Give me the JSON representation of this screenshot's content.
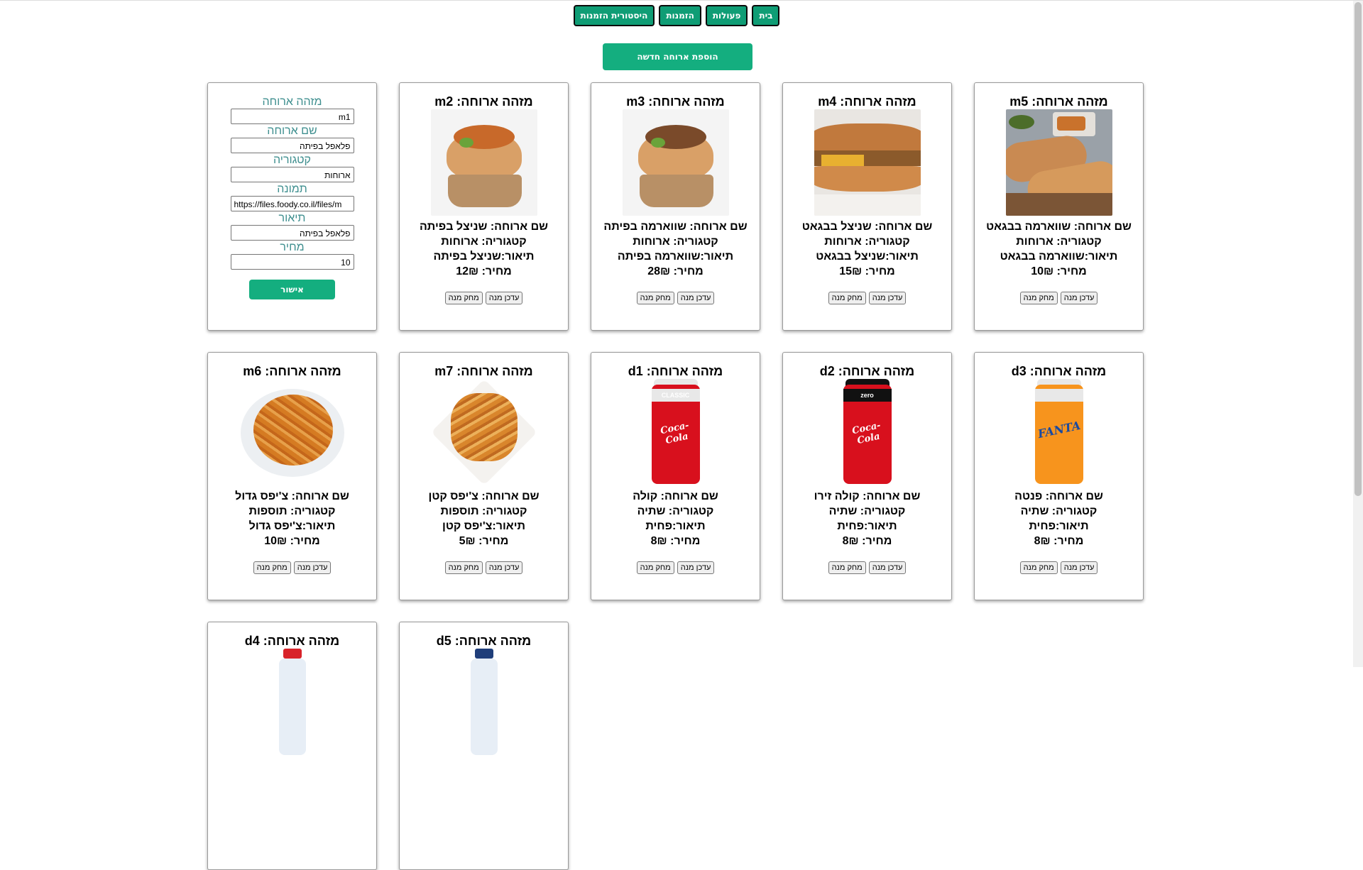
{
  "nav": {
    "items": [
      {
        "label": "בית"
      },
      {
        "label": "פעולות"
      },
      {
        "label": "הזמנות"
      },
      {
        "label": "היסטורית הזמנות"
      }
    ]
  },
  "add_meal_label": "הוספת ארוחה חדשה",
  "form": {
    "fields": [
      {
        "label": "מזהה ארוחה",
        "value": "m1"
      },
      {
        "label": "שם ארוחה",
        "value": "פלאפל בפיתה"
      },
      {
        "label": "קטגוריה",
        "value": "ארוחות"
      },
      {
        "label": "תמונה",
        "value": "https://files.foody.co.il/files/m"
      },
      {
        "label": "תיאור",
        "value": "פלאפל בפיתה"
      },
      {
        "label": "מחיר",
        "value": "10"
      }
    ],
    "submit_label": "אישור"
  },
  "labels": {
    "update": "עדכן מנה",
    "delete": "מחק מנה"
  },
  "cards": [
    {
      "id_text": "מזהה ארוחה: m2",
      "name_text": "שם ארוחה: שניצל בפיתה",
      "category_text": "קטגוריה: ארוחות",
      "desc_text": "תיאור:שניצל בפיתה",
      "price_text": "מחיר: 12₪",
      "icon": "pita-sandwich-photo"
    },
    {
      "id_text": "מזהה ארוחה: m3",
      "name_text": "שם ארוחה: שווארמה בפיתה",
      "category_text": "קטגוריה: ארוחות",
      "desc_text": "תיאור:שווארמה בפיתה",
      "price_text": "מחיר: 28₪",
      "icon": "pita-shawarma-photo"
    },
    {
      "id_text": "מזהה ארוחה: m4",
      "name_text": "שם ארוחה: שניצל בבגאט",
      "category_text": "קטגוריה: ארוחות",
      "desc_text": "תיאור:שניצל בבגאט",
      "price_text": "מחיר: 15₪",
      "icon": "baguette-photo"
    },
    {
      "id_text": "מזהה ארוחה: m5",
      "name_text": "שם ארוחה: שווארמה בבגאט",
      "category_text": "קטגוריה: ארוחות",
      "desc_text": "תיאור:שווארמה בבגאט",
      "price_text": "מחיר: 10₪",
      "icon": "baguette-shawarma-photo"
    },
    {
      "id_text": "מזהה ארוחה: m6",
      "name_text": "שם ארוחה: צ'יפס גדול",
      "category_text": "קטגוריה: תוספות",
      "desc_text": "תיאור:צ'יפס גדול",
      "price_text": "מחיר: 10₪",
      "icon": "fries-plate-photo"
    },
    {
      "id_text": "מזהה ארוחה: m7",
      "name_text": "שם ארוחה: צ'יפס קטן",
      "category_text": "קטגוריה: תוספות",
      "desc_text": "תיאור:צ'יפס קטן",
      "price_text": "מחיר: 5₪",
      "icon": "fries-bowl-photo"
    },
    {
      "id_text": "מזהה ארוחה: d1",
      "name_text": "שם ארוחה: קולה",
      "category_text": "קטגוריה: שתיה",
      "desc_text": "תיאור:פחית",
      "price_text": "מחיר: 8₪",
      "icon": "cola-can-photo",
      "can": {
        "body": "#d8101d",
        "top": "#e8e8e8",
        "band": "CLASSIC",
        "logo": "Coca-Cola"
      }
    },
    {
      "id_text": "מזהה ארוחה: d2",
      "name_text": "שם ארוחה: קולה זירו",
      "category_text": "קטגוריה: שתיה",
      "desc_text": "תיאור:פחית",
      "price_text": "מחיר: 8₪",
      "icon": "cola-zero-can-photo",
      "can": {
        "body": "#d8101d",
        "top": "#111111",
        "band": "zero",
        "logo": "Coca-Cola"
      }
    },
    {
      "id_text": "מזהה ארוחה: d3",
      "name_text": "שם ארוחה: פנטה",
      "category_text": "קטגוריה: שתיה",
      "desc_text": "תיאור:פחית",
      "price_text": "מחיר: 8₪",
      "icon": "fanta-can-photo",
      "can": {
        "body": "#f7941d",
        "top": "#e8e8e8",
        "band": "",
        "logo": "FANTA"
      }
    },
    {
      "id_text": "מזהה ארוחה: d4",
      "name_text": "",
      "category_text": "",
      "desc_text": "",
      "price_text": "",
      "icon": "water-bottle-photo"
    },
    {
      "id_text": "מזהה ארוחה: d5",
      "name_text": "",
      "category_text": "",
      "desc_text": "",
      "price_text": "",
      "icon": "bottle-photo"
    }
  ]
}
